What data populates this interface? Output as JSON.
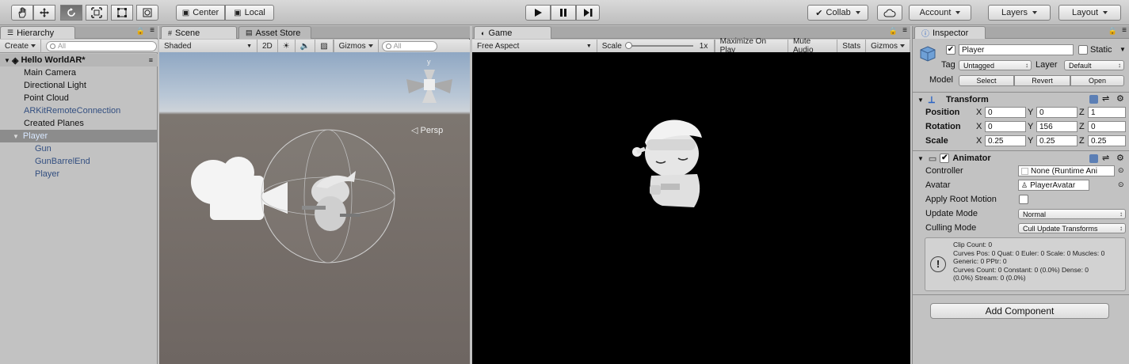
{
  "toolbar": {
    "center_label": "Center",
    "local_label": "Local",
    "collab_label": "Collab",
    "account_label": "Account",
    "layers_label": "Layers",
    "layout_label": "Layout"
  },
  "hierarchy": {
    "tab": "Hierarchy",
    "create_label": "Create",
    "search_placeholder": "All",
    "scene_name": "Hello WorldAR*",
    "items": [
      {
        "label": "Main Camera"
      },
      {
        "label": "Directional Light"
      },
      {
        "label": "Point Cloud"
      },
      {
        "label": "ARKitRemoteConnection"
      },
      {
        "label": "Created Planes"
      },
      {
        "label": "Player"
      },
      {
        "label": "Gun"
      },
      {
        "label": "GunBarrelEnd"
      },
      {
        "label": "Player"
      }
    ]
  },
  "scene": {
    "tab": "Scene",
    "tab2": "Asset Store",
    "shading": "Shaded",
    "mode_2d": "2D",
    "gizmos": "Gizmos",
    "search_placeholder": "All",
    "persp": "◁ Persp",
    "gizmo_axis": "y"
  },
  "game": {
    "tab": "Game",
    "aspect": "Free Aspect",
    "scale_label": "Scale",
    "scale_value": "1x",
    "maximize": "Maximize On Play",
    "mute": "Mute Audio",
    "stats": "Stats",
    "gizmos": "Gizmos"
  },
  "inspector": {
    "tab": "Inspector",
    "object_name": "Player",
    "static_label": "Static",
    "tag_label": "Tag",
    "tag_value": "Untagged",
    "layer_label": "Layer",
    "layer_value": "Default",
    "model_label": "Model",
    "select": "Select",
    "revert": "Revert",
    "open": "Open",
    "transform": {
      "title": "Transform",
      "position_label": "Position",
      "rotation_label": "Rotation",
      "scale_label": "Scale",
      "axis_x": "X",
      "axis_y": "Y",
      "axis_z": "Z",
      "position": [
        "0",
        "0",
        "1"
      ],
      "rotation": [
        "0",
        "156",
        "0"
      ],
      "scale": [
        "0.25",
        "0.25",
        "0.25"
      ]
    },
    "animator": {
      "title": "Animator",
      "controller_label": "Controller",
      "controller_value": "None (Runtime Ani",
      "avatar_label": "Avatar",
      "avatar_value": "PlayerAvatar",
      "apply_root_label": "Apply Root Motion",
      "update_mode_label": "Update Mode",
      "update_mode_value": "Normal",
      "culling_mode_label": "Culling Mode",
      "culling_mode_value": "Cull Update Transforms",
      "info_lines": [
        "Clip Count: 0",
        "Curves Pos: 0 Quat: 0 Euler: 0 Scale: 0 Muscles: 0",
        "Generic: 0 PPtr: 0",
        "Curves Count: 0 Constant: 0 (0.0%) Dense: 0",
        "(0.0%) Stream: 0 (0.0%)"
      ]
    },
    "add_component": "Add Component"
  },
  "colors": {
    "selection": "#8c8c8c",
    "prefab_text": "#334f80",
    "game_bg": "#000000"
  }
}
